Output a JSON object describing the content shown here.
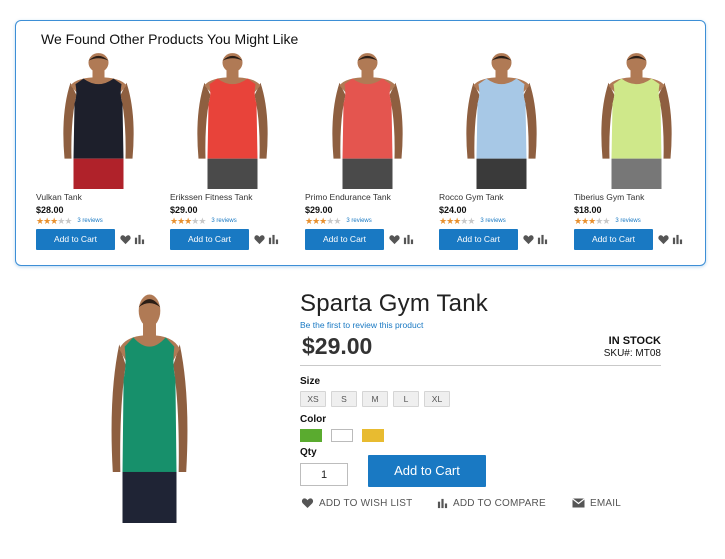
{
  "recommendations": {
    "title": "We Found Other Products You Might Like",
    "products": [
      {
        "name": "Vulkan Tank",
        "price": "$28.00",
        "rating": 3,
        "reviews": "3 reviews",
        "add_to_cart": "Add to Cart",
        "shirt_color": "#1d1f2b",
        "shorts_color": "#b0222a"
      },
      {
        "name": "Erikssen Fitness Tank",
        "price": "$29.00",
        "rating": 3,
        "reviews": "3 reviews",
        "add_to_cart": "Add to Cart",
        "shirt_color": "#e8433a",
        "shorts_color": "#4a4a4a"
      },
      {
        "name": "Primo Endurance Tank",
        "price": "$29.00",
        "rating": 3,
        "reviews": "3 reviews",
        "add_to_cart": "Add to Cart",
        "shirt_color": "#e4554f",
        "shorts_color": "#4a4a4a"
      },
      {
        "name": "Rocco Gym Tank",
        "price": "$24.00",
        "rating": 3,
        "reviews": "3 reviews",
        "add_to_cart": "Add to Cart",
        "shirt_color": "#a7c8e6",
        "shorts_color": "#3a3a3a"
      },
      {
        "name": "Tiberius Gym Tank",
        "price": "$18.00",
        "rating": 3,
        "reviews": "3 reviews",
        "add_to_cart": "Add to Cart",
        "shirt_color": "#cfe88a",
        "shorts_color": "#777777"
      }
    ]
  },
  "product": {
    "title": "Sparta Gym Tank",
    "review_link": "Be the first to review this product",
    "price": "$29.00",
    "stock": "IN STOCK",
    "sku": "SKU#: MT08",
    "size_label": "Size",
    "sizes": [
      "XS",
      "S",
      "M",
      "L",
      "XL"
    ],
    "color_label": "Color",
    "colors": [
      "#5aab2f",
      "#ffffff",
      "#e8bb30"
    ],
    "qty_label": "Qty",
    "qty_value": "1",
    "add_to_cart": "Add to Cart",
    "wishlist": "ADD TO WISH LIST",
    "compare": "ADD TO COMPARE",
    "email": "EMAIL",
    "shirt_color": "#17906b",
    "shorts_color": "#1f2435"
  },
  "colors": {
    "primary": "#1979c3",
    "panel_border": "#3d8fd6",
    "star": "#e8902e"
  }
}
